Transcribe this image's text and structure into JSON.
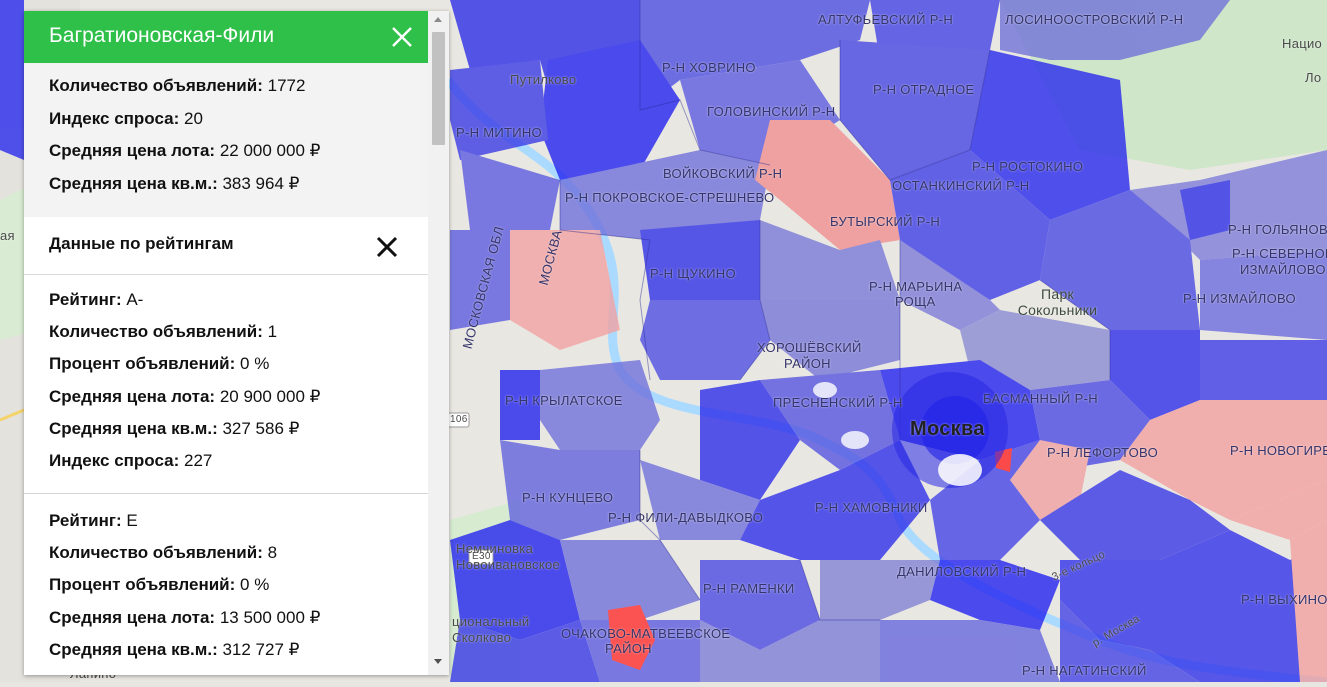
{
  "panel": {
    "title": "Багратионовская-Фили",
    "summary": [
      {
        "label": "Количество объявлений:",
        "value": "1772"
      },
      {
        "label": "Индекс спроса:",
        "value": "20"
      },
      {
        "label": "Средняя цена лота:",
        "value": "22 000 000 ₽"
      },
      {
        "label": "Средняя цена кв.м.:",
        "value": "383 964 ₽"
      }
    ],
    "ratings_title": "Данные по рейтингам",
    "ratings": [
      {
        "rows": [
          {
            "label": "Рейтинг:",
            "value": "А-"
          },
          {
            "label": "Количество объявлений:",
            "value": "1"
          },
          {
            "label": "Процент объявлений:",
            "value": "0 %"
          },
          {
            "label": "Средняя цена лота:",
            "value": "20 900 000 ₽"
          },
          {
            "label": "Средняя цена кв.м.:",
            "value": "327 586 ₽"
          },
          {
            "label": "Индекс спроса:",
            "value": "227"
          }
        ]
      },
      {
        "rows": [
          {
            "label": "Рейтинг:",
            "value": "Е"
          },
          {
            "label": "Количество объявлений:",
            "value": "8"
          },
          {
            "label": "Процент объявлений:",
            "value": "0 %"
          },
          {
            "label": "Средняя цена лота:",
            "value": "13 500 000 ₽"
          },
          {
            "label": "Средняя цена кв.м.:",
            "value": "312 727 ₽"
          }
        ]
      }
    ]
  },
  "map": {
    "city_label": "Москва",
    "districts": {
      "altufevsky": "АЛТУФЬЕВСКИЙ Р-Н",
      "losinoostrovsky": "ЛОСИНООСТРОВСКИЙ Р-Н",
      "khovrino": "Р-Н ХОВРИНО",
      "otradnoe": "Р-Н ОТРАДНОЕ",
      "golovinsky": "ГОЛОВИНСКИЙ Р-Н",
      "mitino": "Р-Н МИТИНО",
      "rostokino": "Р-Н РОСТОКИНО",
      "voykovsky": "ВОЙКОВСКИЙ Р-Н",
      "ostankinsky": "ОСТАНКИНСКИЙ Р-Н",
      "pokrovskoe": "Р-Н ПОКРОВСКОЕ-СТРЕШНЕВО",
      "butyrsky": "БУТЫРСКИЙ Р-Н",
      "golyanovo": "Р-Н ГОЛЬЯНОВО",
      "severnoe_izmaylovo_1": "Р-Н СЕВЕРНОЕ",
      "severnoe_izmaylovo_2": "ИЗМАЙЛОВО",
      "shchukino": "Р-Н ЩУКИНО",
      "maryina_1": "Р-Н МАРЬИНА",
      "maryina_2": "РОЩА",
      "izmaylovo": "Р-Н ИЗМАЙЛОВО",
      "khoroshevsky_1": "ХОРОШЁВСКИЙ",
      "khoroshevsky_2": "РАЙОН",
      "krylatskoe": "Р-Н КРЫЛАТСКОЕ",
      "presnensky": "ПРЕСНЕНСКИЙ Р-Н",
      "basmanny": "БАСМАННЫЙ Р-Н",
      "lefortovo": "Р-Н ЛЕФОРТОВО",
      "novogireevo": "Р-Н НОВОГИРЕ",
      "kuntsevo": "Р-Н КУНЦЕВО",
      "fili": "Р-Н ФИЛИ-ДАВЫДКОВО",
      "khamovniki": "Р-Н ХАМОВНИКИ",
      "ramenki": "Р-Н РАМЕНКИ",
      "danilovsky": "ДАНИЛОВСКИЙ Р-Н",
      "vykhino": "Р-Н ВЫХИНО",
      "ochakovo_1": "ОЧАКОВО-МАТВЕЕВСКОЕ",
      "ochakovo_2": "РАЙОН",
      "nagatinsky": "Р-Н НАГАТИНСКИЙ",
      "moskovskaya_obl": "МОСКОВСКАЯ ОБЛ",
      "moskva_vertical": "МОСКВА"
    },
    "places": {
      "putilkovo": "Путилково",
      "nemchinovka": "Немчиновка",
      "novoivanovskoe": "Новоивановское",
      "lapino": "Лапино",
      "skolkovo": "Сколково",
      "natsio": "Нацио",
      "park_1": "Парк",
      "park_2": "Сокольники",
      "ring": "3-е кольцо",
      "moskva_river": "р. Москва",
      "road_106": "106",
      "road_e30": "Е30",
      "fragment_yaya": "ая",
      "fragment_l": "Ло",
      "fragment_ts": "циональный"
    }
  },
  "colors": {
    "header_green": "#2fc04a",
    "blue_dark": "#2424e6",
    "blue_mid": "#4646e0",
    "blue_light": "#7c7cd9",
    "red_light": "#f09a9a",
    "red_bright": "#ff3a3a"
  }
}
